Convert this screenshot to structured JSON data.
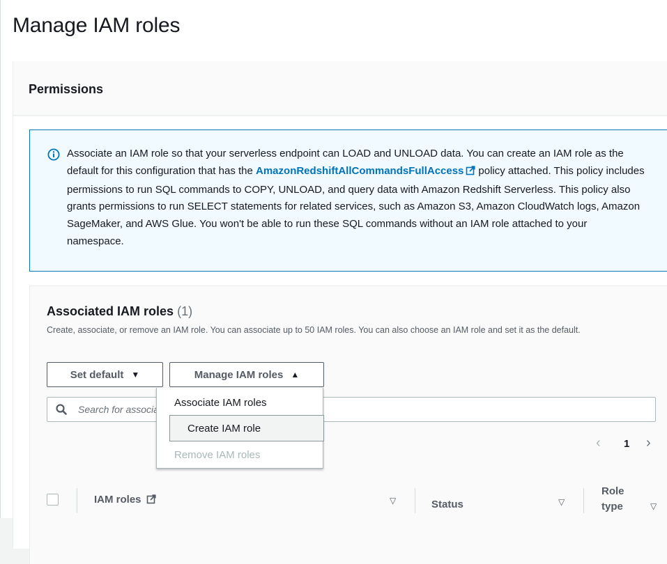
{
  "page": {
    "title": "Manage IAM roles"
  },
  "permissions": {
    "title": "Permissions"
  },
  "alert": {
    "text_before": "Associate an IAM role so that your serverless endpoint can LOAD and UNLOAD data. You can create an IAM role as the default for this configuration that has the",
    "link": "AmazonRedshiftAllCommandsFullAccess",
    "text_after": "policy attached. This policy includes permissions to run SQL commands to COPY, UNLOAD, and query data with Amazon Redshift Serverless. This policy also grants permissions to run SELECT statements for related services, such as Amazon S3, Amazon CloudWatch logs, Amazon SageMaker, and AWS Glue. You won't be able to run these SQL commands without an IAM role attached to your namespace."
  },
  "associated": {
    "title": "Associated IAM roles",
    "count": "(1)",
    "description": "Create, associate, or remove an IAM role. You can associate up to 50 IAM roles. You can also choose an IAM role and set it as the default."
  },
  "buttons": {
    "set_default": "Set default",
    "set_default_caret": "▼",
    "manage": "Manage IAM roles",
    "manage_caret": "▲"
  },
  "search": {
    "placeholder": "Search for associated IAM roles by name or role type"
  },
  "pagination": {
    "prev": "‹",
    "page": "1",
    "next": "›"
  },
  "table": {
    "columns": [
      {
        "label": "IAM roles"
      },
      {
        "label": "Status"
      },
      {
        "label": "Role type"
      }
    ],
    "sort_glyph": "▽"
  },
  "dropdown": {
    "items": [
      {
        "label": "Associate IAM roles",
        "state": "normal"
      },
      {
        "label": "Create IAM role",
        "state": "hover"
      },
      {
        "label": "Remove IAM roles",
        "state": "disabled"
      }
    ]
  },
  "colors": {
    "link": "#0073bb",
    "alert_bg": "#f1faff",
    "alert_border": "#0073bb",
    "disabled_text": "#aab7b8"
  },
  "icons": {
    "alert": "info-circle-icon",
    "external": "external-link-icon",
    "search": "search-icon",
    "sort": "sort-down-icon"
  }
}
